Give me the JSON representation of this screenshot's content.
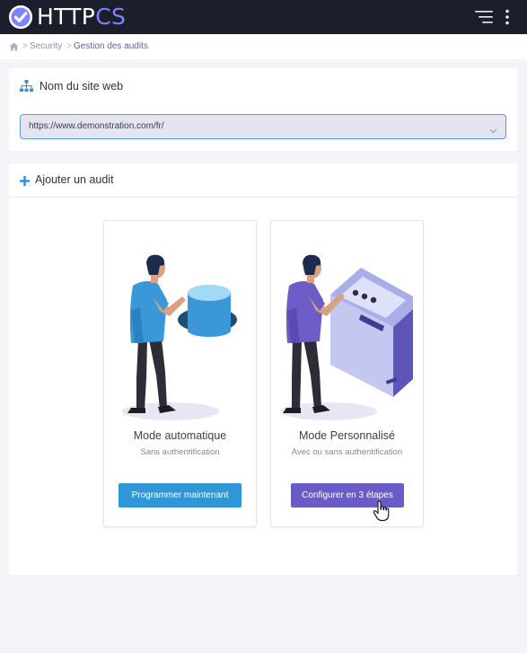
{
  "header": {
    "logo_part1": "HTTP",
    "logo_part2": "CS",
    "menu_icon": "menu-lines-icon",
    "more_icon": "more-vertical-icon"
  },
  "breadcrumb": {
    "home_icon": "home-icon",
    "items": [
      "Security",
      "Gestion des audits"
    ],
    "separator": ">"
  },
  "site_card": {
    "icon": "sitemap-icon",
    "title": "Nom du site web",
    "selected_value": "https://www.demonstration.com/fr/"
  },
  "audit_card": {
    "icon": "plus-icon",
    "title": "Ajouter un audit",
    "modes": [
      {
        "title": "Mode automatique",
        "subtitle": "Sans authentification",
        "button_label": "Programmer maintenant"
      },
      {
        "title": "Mode Personnalisé",
        "subtitle": "Avec ou sans authentification",
        "button_label": "Configurer en 3 étapes"
      }
    ]
  },
  "colors": {
    "topbar": "#1d1e2c",
    "brand_accent": "#7e84ff",
    "primary_blue": "#3097d6",
    "primary_purple": "#6a5cc6",
    "breadcrumb_active": "#5a5fa8",
    "icon_blue": "#2d8fd5"
  }
}
